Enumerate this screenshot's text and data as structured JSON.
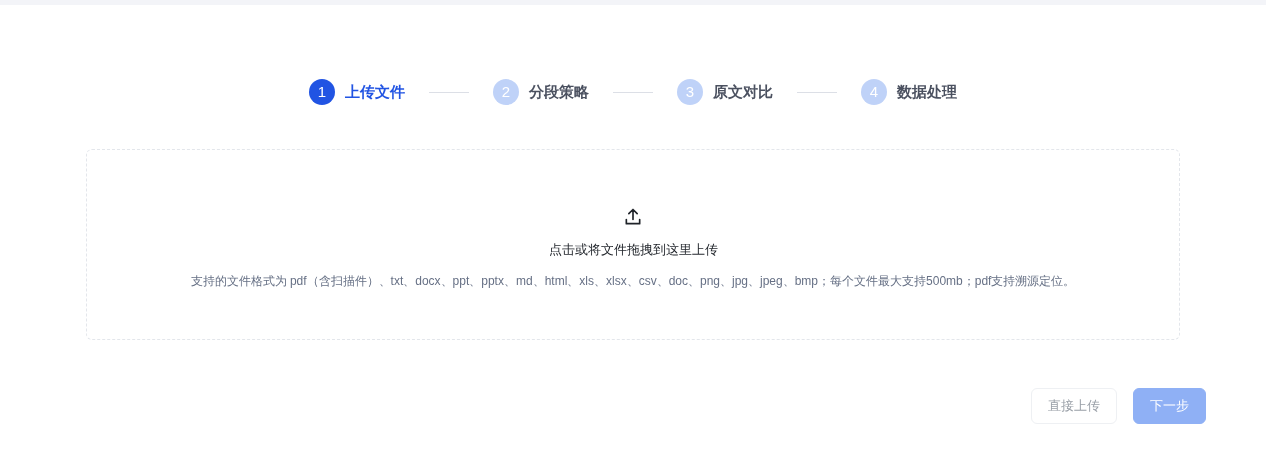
{
  "steps": [
    {
      "number": "1",
      "label": "上传文件",
      "selected": true
    },
    {
      "number": "2",
      "label": "分段策略",
      "selected": false
    },
    {
      "number": "3",
      "label": "原文对比",
      "selected": false
    },
    {
      "number": "4",
      "label": "数据处理",
      "selected": false
    }
  ],
  "upload": {
    "title": "点击或将文件拖拽到这里上传",
    "hint": "支持的文件格式为 pdf（含扫描件）、txt、docx、ppt、pptx、md、html、xls、xlsx、csv、doc、png、jpg、jpeg、bmp；每个文件最大支持500mb；pdf支持溯源定位。"
  },
  "buttons": [
    {
      "kind": "secondary",
      "label": "直接上传",
      "disabled": true
    },
    {
      "kind": "primary",
      "label": "下一步",
      "disabled": true
    }
  ]
}
